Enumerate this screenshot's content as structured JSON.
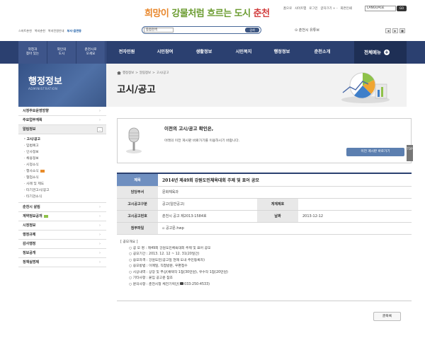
{
  "header": {
    "logo_text": {
      "p1": "희망이 ",
      "p2": "강물처럼 ",
      "p3": "흐르는 도시 ",
      "p4": "춘천"
    },
    "util": [
      "홈으로",
      "사이트맵",
      "로그인",
      "글자크기 + -",
      "화면인쇄"
    ],
    "language_label": "LANGUAGE",
    "go_label": "GO",
    "left_links": [
      "스마트춘천",
      "복지춘천",
      "복지민원안내",
      "부서·읍면동"
    ],
    "search": {
      "select_value": "통합검색",
      "button": "검색"
    },
    "web_link": "춘천시 유튜브",
    "pager": [
      "◀",
      "▶",
      "■"
    ]
  },
  "gnb": {
    "left": [
      "외청과\n찾아 있는",
      "외인의\n도시",
      "춘천시로\n오세요"
    ],
    "menu": [
      "전자민원",
      "시민참여",
      "생활정보",
      "시민복지",
      "행정정보",
      "춘천소개"
    ],
    "all_menu": "전체메뉴",
    "plus_glyph": "+"
  },
  "side": {
    "title": "행정정보",
    "subtitle": "ADMINISTRATION",
    "menu": [
      {
        "label": "시정주요운영방향",
        "arrow": "›"
      },
      {
        "label": "주요업무계획",
        "arrow": "›"
      }
    ],
    "open_menu": {
      "label": "알림정보",
      "arrow": "⌄"
    },
    "submenu": [
      "· 고시/공고",
      "· 입법예고",
      "· 인사정보",
      "· 채용정보",
      "· 시정소식",
      "· 행사소식",
      "· 협업소식",
      "· 사례 및 제도",
      "· 타기관고시/공고",
      "· 타기관소식"
    ],
    "menu_after": [
      {
        "label": "춘천시 살림",
        "arrow": "›"
      },
      {
        "label": "계약정보공개",
        "arrow": "›"
      },
      {
        "label": "시정정보",
        "arrow": "›"
      },
      {
        "label": "행정규제",
        "arrow": "›"
      },
      {
        "label": "감사행정",
        "arrow": "›"
      },
      {
        "label": "정보공개",
        "arrow": "›"
      },
      {
        "label": "정책실명제",
        "arrow": "›"
      }
    ]
  },
  "breadcrumb": [
    "행정정보",
    ">",
    "알림정보",
    ">",
    "고시/공고"
  ],
  "page_title": "고시/공고",
  "notice": {
    "heading": "이전의 고시/공고 확인은,",
    "text": "아래의 이전 게시판 바로가기를 이용하시기 바랍니다.",
    "button": "이전 게시판 바로가기"
  },
  "top_button": "TOP",
  "view": {
    "subject_label": "제목",
    "subject": "2014년 제49회 강원도민체육대회 주제 및 표어 공모",
    "dept_label": "담당부서",
    "dept": "문화체육과",
    "type_label": "고시공고구분",
    "type": "공고(일반공고)",
    "writer_label": "게재제호",
    "writer": "",
    "no_label": "고시공고번호",
    "no": "춘천시 공고 제2013-1584호",
    "date_label": "날짜",
    "date": "2013-12-12",
    "file_label": "첨부파일",
    "file": "공고문.hwp"
  },
  "content": {
    "heading": "[ 공모개요 ]",
    "lines": [
      "○ 공 모 명 : 제49회 강원도민체육대회 주제 및 표어 공모",
      "○ 공모기간 : 2013. 12. 12 ~ 12. 31(20일간)",
      "○ 응모자격 : 강원도민(공고일 현재 도내 주민등록자)",
      "○ 응모방법 : 이메일, 직접방문, 우편접수",
      "○ 시상내역 : 상장 및 부상(채택작 1점(30만원), 우수작 1점(20만원)",
      "○ 기타사항 : 붙임 공고문 참조"
    ],
    "contact_prefix": "○ 문의사항 : 춘천시청 체전기획단(",
    "contact_suffix": "033-250-4533)"
  },
  "list_button": "글목록"
}
